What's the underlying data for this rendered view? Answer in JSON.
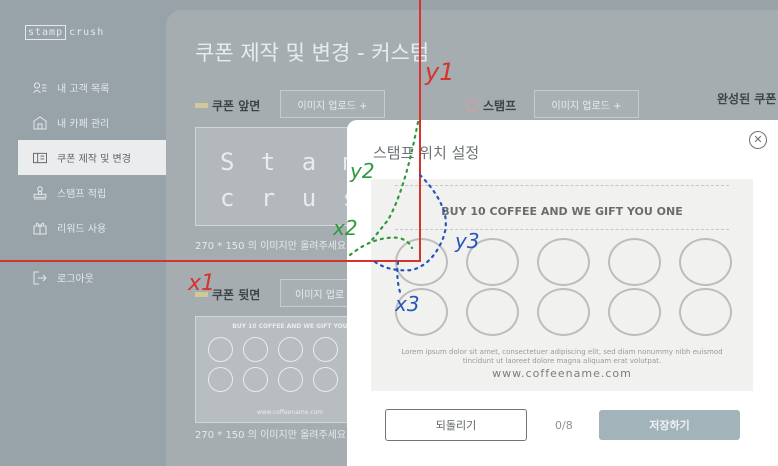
{
  "sidebar": {
    "logo_boxed": "stamp",
    "logo_rest": "crush",
    "items": [
      {
        "label": "내 고객 목록",
        "icon": "customer-list-icon"
      },
      {
        "label": "내 카페 관리",
        "icon": "cafe-icon"
      },
      {
        "label": "쿠폰 제작 및 변경",
        "icon": "coupon-icon",
        "active": true
      },
      {
        "label": "스탬프 적립",
        "icon": "stamp-icon"
      },
      {
        "label": "리워드 사용",
        "icon": "gift-icon"
      },
      {
        "label": "로그아웃",
        "icon": "logout-icon"
      }
    ]
  },
  "main": {
    "title": "쿠폰 제작 및 변경 - 커스텀",
    "front_label": "쿠폰 앞면",
    "back_label": "쿠폰 뒷면",
    "stamp_label": "스탬프",
    "upload_label": "이미지 업로드 +",
    "upload_label_partial": "이미지 업로",
    "completed_label": "완성된 쿠폰",
    "front_preview_line1": "S t a m",
    "front_preview_line2": "c r u s",
    "hint_text": "270 * 150 의 이미지만 올려주세요",
    "back_preview_head": "BUY 10 COFFEE AND WE GIFT YOU",
    "back_preview_url": "www.coffeename.com"
  },
  "modal": {
    "title": "스탬프 위치 설정",
    "close_icon": "close-icon",
    "coupon_headline": "BUY 10 COFFEE AND WE GIFT YOU ONE",
    "coupon_fine_print": "Lorem ipsum dolor sit amet, consectetuer adipiscing elit, sed diam nonummy nibh euismod tincidunt ut laoreet dolore magna aliquam erat volutpat.",
    "coupon_url": "www.coffeename.com",
    "reset_label": "되돌리기",
    "counter": "0/8",
    "save_label": "저장하기"
  },
  "annotations": {
    "y1": "y1",
    "y2": "y2",
    "y3": "y3",
    "x1": "x1",
    "x2": "x2",
    "x3": "x3"
  },
  "colors": {
    "annotation_red": "#d8322f",
    "annotation_green": "#2f9a3c",
    "annotation_blue": "#2856b8"
  }
}
